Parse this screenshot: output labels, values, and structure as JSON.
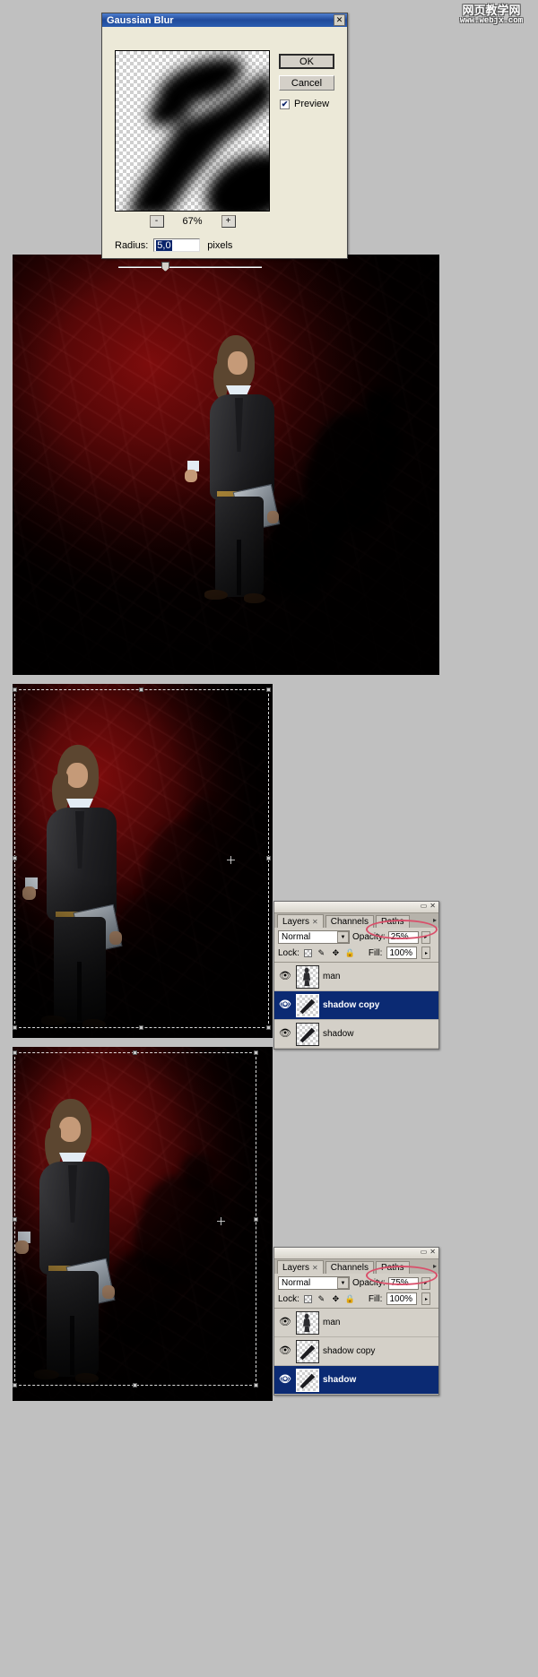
{
  "watermark": {
    "cn": "网页教学网",
    "url": "www.webjx.com"
  },
  "dialog": {
    "title": "Gaussian Blur",
    "close_label": "✕",
    "ok_label": "OK",
    "cancel_label": "Cancel",
    "preview_label": "Preview",
    "preview_checked": "✔",
    "zoom_out_label": "-",
    "zoom_in_label": "+",
    "zoom_value": "67%",
    "radius_label": "Radius:",
    "radius_value": "5,0",
    "radius_units": "pixels"
  },
  "palette1": {
    "tabs": [
      {
        "label": "Layers",
        "close": "✕",
        "active": true
      },
      {
        "label": "Channels",
        "close": "",
        "active": false
      },
      {
        "label": "Paths",
        "close": "",
        "active": false
      }
    ],
    "menu_glyph": "▸",
    "min_glyph": "▭",
    "close_glyph": "✕",
    "blend_mode": "Normal",
    "blend_arrow": "▼",
    "opacity_label": "Opacity:",
    "opacity_value": "25%",
    "opacity_arrow": "▸",
    "lock_label": "Lock:",
    "lock_icons": [
      "transparency-lock",
      "brush-lock",
      "move-lock",
      "all-lock"
    ],
    "lock_brush": "✎",
    "lock_move": "✥",
    "lock_all": "🔒",
    "fill_label": "Fill:",
    "fill_value": "100%",
    "fill_arrow": "▸",
    "eye_glyph": "👁",
    "layers": [
      {
        "name": "man",
        "visible": true,
        "selected": false
      },
      {
        "name": "shadow copy",
        "visible": true,
        "selected": true
      },
      {
        "name": "shadow",
        "visible": true,
        "selected": false
      }
    ]
  },
  "palette2": {
    "tabs": [
      {
        "label": "Layers",
        "close": "✕",
        "active": true
      },
      {
        "label": "Channels",
        "close": "",
        "active": false
      },
      {
        "label": "Paths",
        "close": "",
        "active": false
      }
    ],
    "menu_glyph": "▸",
    "min_glyph": "▭",
    "close_glyph": "✕",
    "blend_mode": "Normal",
    "blend_arrow": "▼",
    "opacity_label": "Opacity:",
    "opacity_value": "75%",
    "opacity_arrow": "▸",
    "lock_label": "Lock:",
    "lock_brush": "✎",
    "lock_move": "✥",
    "lock_all": "🔒",
    "fill_label": "Fill:",
    "fill_value": "100%",
    "fill_arrow": "▸",
    "eye_glyph": "👁",
    "layers": [
      {
        "name": "man",
        "visible": true,
        "selected": false
      },
      {
        "name": "shadow copy",
        "visible": true,
        "selected": false
      },
      {
        "name": "shadow",
        "visible": true,
        "selected": true
      }
    ]
  },
  "colors": {
    "accent_red": "#7d0c0c",
    "title_blue": "#204a9a",
    "selection_blue": "#0b2a73",
    "highlight_ring": "#d94f6a",
    "panel_gray": "#d4d0c8",
    "canvas_gray": "#c0c0c0"
  }
}
